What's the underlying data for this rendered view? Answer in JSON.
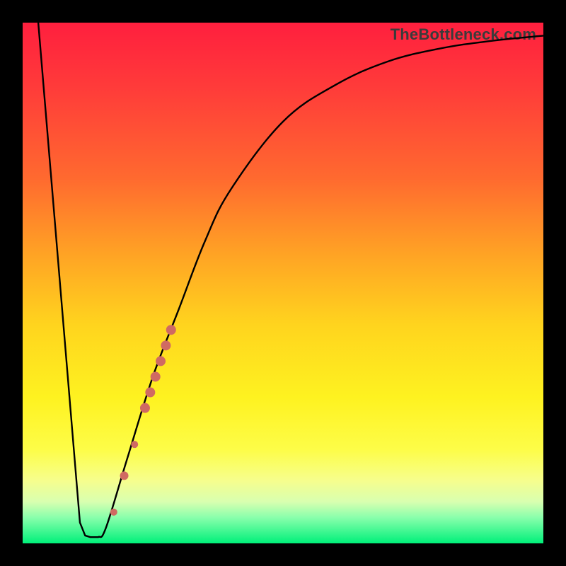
{
  "watermark": "TheBottleneck.com",
  "colors": {
    "curve_stroke": "#000000",
    "marker_fill": "#d06a62",
    "frame_bg": "#000000"
  },
  "chart_data": {
    "type": "line",
    "title": "",
    "xlabel": "",
    "ylabel": "",
    "xlim": [
      0,
      100
    ],
    "ylim": [
      0,
      100
    ],
    "curve_points": [
      {
        "x": 3,
        "y": 100
      },
      {
        "x": 11,
        "y": 4
      },
      {
        "x": 12,
        "y": 1.5
      },
      {
        "x": 13,
        "y": 1.2
      },
      {
        "x": 14.5,
        "y": 1.2
      },
      {
        "x": 16,
        "y": 3
      },
      {
        "x": 20,
        "y": 16
      },
      {
        "x": 25,
        "y": 32
      },
      {
        "x": 30,
        "y": 45
      },
      {
        "x": 35,
        "y": 58
      },
      {
        "x": 40,
        "y": 68
      },
      {
        "x": 50,
        "y": 81
      },
      {
        "x": 60,
        "y": 88
      },
      {
        "x": 70,
        "y": 92.5
      },
      {
        "x": 80,
        "y": 95
      },
      {
        "x": 90,
        "y": 96.5
      },
      {
        "x": 100,
        "y": 97.5
      }
    ],
    "markers": [
      {
        "x": 17.5,
        "y": 6,
        "r": 5
      },
      {
        "x": 19.5,
        "y": 13,
        "r": 6
      },
      {
        "x": 21.5,
        "y": 19,
        "r": 5
      },
      {
        "x": 23.5,
        "y": 26,
        "r": 7
      },
      {
        "x": 24.5,
        "y": 29,
        "r": 7
      },
      {
        "x": 25.5,
        "y": 32,
        "r": 7
      },
      {
        "x": 26.5,
        "y": 35,
        "r": 7
      },
      {
        "x": 27.5,
        "y": 38,
        "r": 7
      },
      {
        "x": 28.5,
        "y": 41,
        "r": 7
      }
    ]
  }
}
